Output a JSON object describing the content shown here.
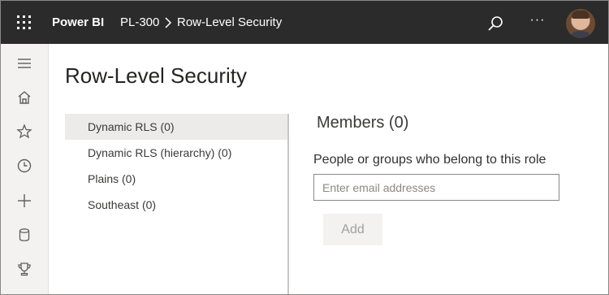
{
  "header": {
    "app_name": "Power BI",
    "workspace": "PL-300",
    "page": "Row-Level Security",
    "icons": {
      "launcher": "waffle-icon",
      "separator": "chevron-right-icon",
      "search": "search-icon",
      "more": "more-icon"
    },
    "more_glyph": "···"
  },
  "nav": {
    "items": [
      "hamburger-icon",
      "home-icon",
      "star-icon",
      "clock-icon",
      "plus-icon",
      "database-icon",
      "trophy-icon"
    ]
  },
  "page": {
    "title": "Row-Level Security"
  },
  "roles": {
    "items": [
      {
        "label": "Dynamic RLS (0)",
        "selected": true
      },
      {
        "label": "Dynamic RLS (hierarchy) (0)",
        "selected": false
      },
      {
        "label": "Plains (0)",
        "selected": false
      },
      {
        "label": "Southeast (0)",
        "selected": false
      }
    ]
  },
  "members": {
    "title": "Members (0)",
    "label": "People or groups who belong to this role",
    "input_placeholder": "Enter email addresses",
    "input_value": "",
    "add_label": "Add"
  },
  "colors": {
    "topbar": "#2b2b2b",
    "nav_bg": "#f3f2f1",
    "selected_bg": "#edebe9"
  }
}
